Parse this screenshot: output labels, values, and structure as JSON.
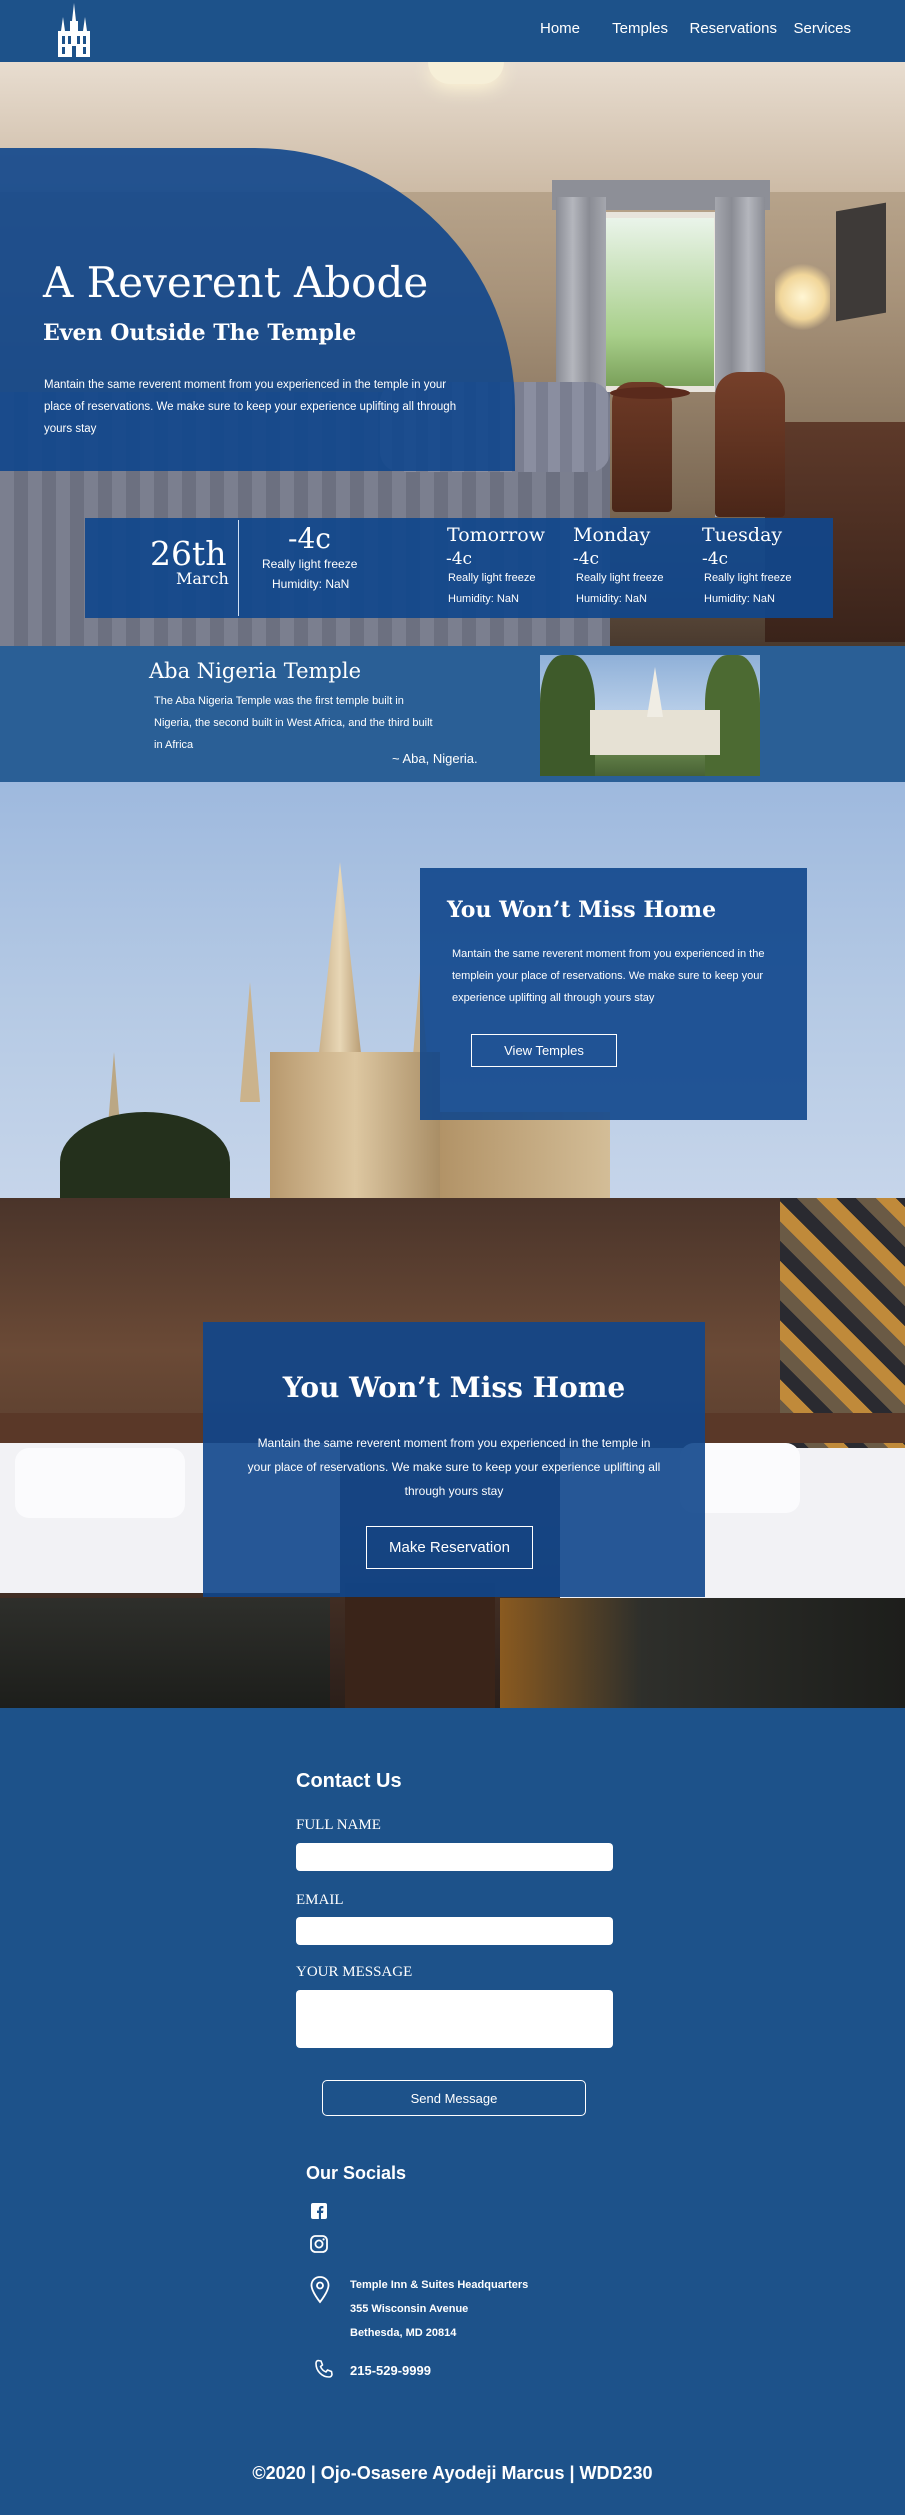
{
  "nav": {
    "items": [
      "Home",
      "Temples",
      "Reservations",
      "Services"
    ]
  },
  "hero": {
    "title": "A Reverent Abode",
    "subtitle": "Even Outside The Temple",
    "text": "Mantain the same reverent moment from you experienced in the temple in your place of reservations. We make sure to keep your experience uplifting all through yours stay"
  },
  "weather": {
    "day": "26th",
    "month": "March",
    "temp": "-4c",
    "desc": "Really light freeze",
    "humidity": "Humidity: NaN",
    "forecast": [
      {
        "day": "Tomorrow",
        "temp": "-4c",
        "desc": "Really light freeze",
        "humidity": "Humidity: NaN"
      },
      {
        "day": "Monday",
        "temp": "-4c",
        "desc": "Really light freeze",
        "humidity": "Humidity: NaN"
      },
      {
        "day": "Tuesday",
        "temp": "-4c",
        "desc": "Really light freeze",
        "humidity": "Humidity: NaN"
      }
    ]
  },
  "temple_strip": {
    "title": "Aba Nigeria Temple",
    "text": "The Aba Nigeria Temple was the first temple built in Nigeria, the second built in West Africa, and the third built in Africa",
    "cite": "~ Aba, Nigeria."
  },
  "section2": {
    "title": "You Won’t Miss Home",
    "text": "Mantain the same reverent moment from you experienced in the templein your place of reservations. We make sure to keep your experience uplifting all through yours stay",
    "button": "View Temples"
  },
  "section3": {
    "title": "You Won’t Miss Home",
    "text": "Mantain the same reverent moment from you experienced in the temple in your place of reservations. We make sure to keep your experience uplifting all through yours stay",
    "button": "Make Reservation"
  },
  "contact": {
    "title": "Contact Us",
    "name_label": "FULL NAME",
    "email_label": "EMAIL",
    "message_label": "YOUR MESSAGE",
    "send": "Send Message"
  },
  "socials": {
    "title": "Our Socials",
    "icons": [
      "facebook-icon",
      "instagram-icon"
    ],
    "address": [
      "Temple Inn & Suites Headquarters",
      "355 Wisconsin Avenue",
      "Bethesda, MD 20814"
    ],
    "phone": "215-529-9999"
  },
  "footer": "©2020 | Ojo-Osasere Ayodeji Marcus | WDD230",
  "colors": {
    "brand": "#1d528a",
    "panel": "#10468c"
  }
}
